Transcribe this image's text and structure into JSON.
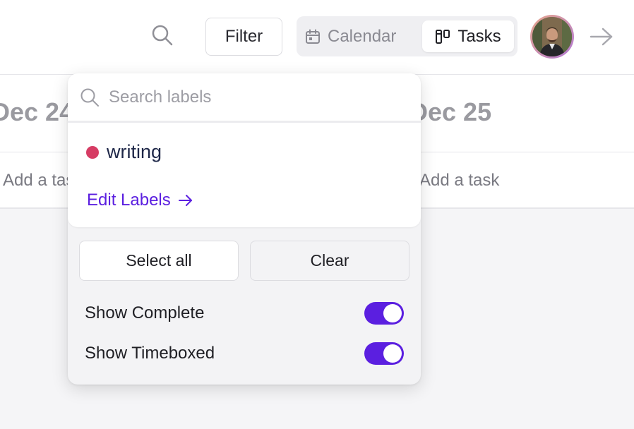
{
  "colors": {
    "accent": "#5b1fe0",
    "label_writing": "#d63c64",
    "toggle_on": "#5b1fe0"
  },
  "topbar": {
    "search_icon": "search-icon",
    "filter_label": "Filter",
    "views": [
      {
        "label": "Calendar",
        "icon": "calendar-icon",
        "active": false
      },
      {
        "label": "Tasks",
        "icon": "tasks-icon",
        "active": true
      }
    ],
    "next_icon": "arrow-right-icon"
  },
  "background": {
    "date_left": "Dec 24",
    "date_right": "Dec 25",
    "task_left": "Add a task",
    "task_right": "Add a task"
  },
  "popover": {
    "search": {
      "placeholder": "Search labels",
      "value": ""
    },
    "labels": [
      {
        "name": "writing",
        "color": "#d63c64"
      }
    ],
    "edit_labels": "Edit Labels",
    "select_all": "Select all",
    "clear": "Clear",
    "toggles": [
      {
        "label": "Show Complete",
        "on": true
      },
      {
        "label": "Show Timeboxed",
        "on": true
      }
    ]
  }
}
